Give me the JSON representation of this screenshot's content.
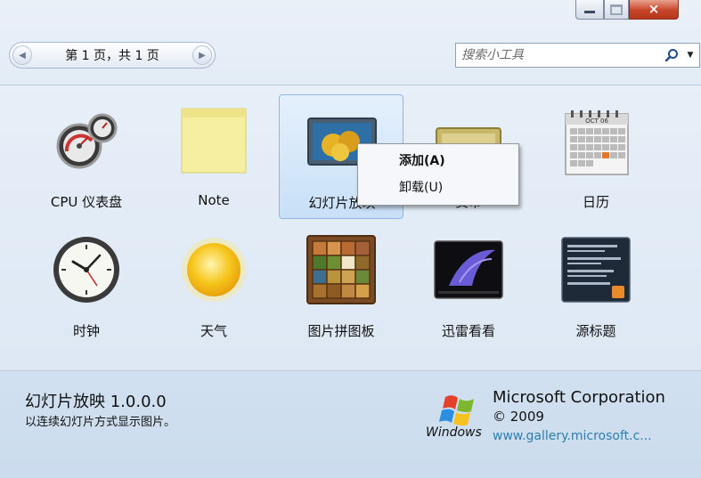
{
  "window": {
    "controls": {
      "minimize": "minimize",
      "maximize": "maximize",
      "close": "×"
    }
  },
  "pager": {
    "text": "第 1 页，共 1 页",
    "prev": "◀",
    "next": "▶"
  },
  "search": {
    "placeholder": "搜索小工具",
    "dropdown": "▼"
  },
  "gadgets": [
    {
      "label": "CPU 仪表盘",
      "icon": "cpu-meter-icon"
    },
    {
      "label": "Note",
      "icon": "sticky-note-icon"
    },
    {
      "label": "幻灯片放映",
      "icon": "slideshow-icon",
      "selected": true
    },
    {
      "label": "货币",
      "icon": "currency-icon"
    },
    {
      "label": "日历",
      "icon": "calendar-icon"
    },
    {
      "label": "时钟",
      "icon": "clock-icon"
    },
    {
      "label": "天气",
      "icon": "weather-sun-icon"
    },
    {
      "label": "图片拼图板",
      "icon": "picture-puzzle-icon"
    },
    {
      "label": "迅雷看看",
      "icon": "video-player-icon"
    },
    {
      "label": "源标题",
      "icon": "feed-headlines-icon"
    }
  ],
  "calendar_icon": {
    "month": "OCT 06"
  },
  "context_menu": {
    "items": [
      {
        "label": "添加(A)"
      },
      {
        "label": "卸载(U)"
      }
    ]
  },
  "details": {
    "title": "幻灯片放映 1.0.0.0",
    "description": "以连续幻灯片方式显示图片。",
    "publisher": "Microsoft Corporation",
    "copyright": "© 2009",
    "url": "www.gallery.microsoft.c...",
    "logo_text": "Windows"
  },
  "colors": {
    "accent": "#2f7fae",
    "close_button": "#c7452a",
    "selection": "#c8e0f8"
  }
}
